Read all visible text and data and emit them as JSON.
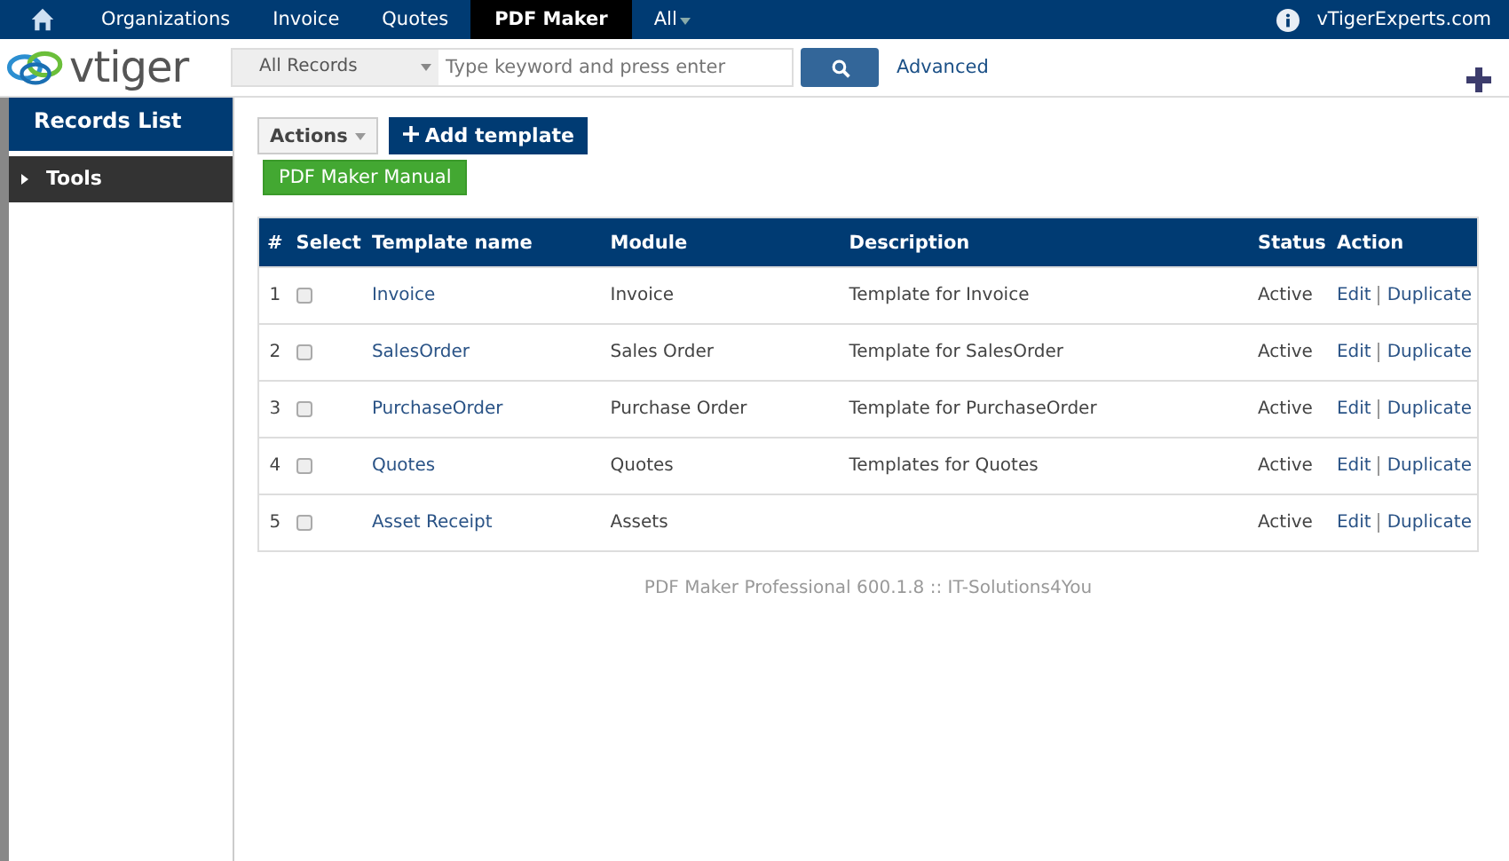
{
  "top_nav": {
    "tabs": [
      {
        "label": "Organizations",
        "selected": false
      },
      {
        "label": "Invoice",
        "selected": false
      },
      {
        "label": "Quotes",
        "selected": false
      },
      {
        "label": "PDF Maker",
        "selected": true
      },
      {
        "label": "All",
        "selected": false
      }
    ],
    "user": "vTigerExperts.com"
  },
  "header": {
    "logo": "vtiger",
    "filter": "All Records",
    "search": {
      "placeholder": "Type keyword and press enter"
    },
    "advanced": "Advanced"
  },
  "sidebar": {
    "title": "Records List",
    "items": [
      {
        "label": "Tools",
        "expanded": false
      }
    ]
  },
  "toolbar": {
    "actions": "Actions",
    "add": "Add template",
    "manual": "PDF Maker Manual"
  },
  "table": {
    "columns": [
      "#",
      "Select",
      "Template name",
      "Module",
      "Description",
      "Status",
      "Action"
    ],
    "rows": [
      {
        "num": "1",
        "checked": false,
        "name": "Invoice",
        "module": "Invoice",
        "description": "Template for Invoice",
        "status": "Active",
        "actions": [
          "Edit",
          "Duplicate"
        ]
      },
      {
        "num": "2",
        "checked": false,
        "name": "SalesOrder",
        "module": "Sales Order",
        "description": "Template for SalesOrder",
        "status": "Active",
        "actions": [
          "Edit",
          "Duplicate"
        ]
      },
      {
        "num": "3",
        "checked": false,
        "name": "PurchaseOrder",
        "module": "Purchase Order",
        "description": "Template for PurchaseOrder",
        "status": "Active",
        "actions": [
          "Edit",
          "Duplicate"
        ]
      },
      {
        "num": "4",
        "checked": false,
        "name": "Quotes",
        "module": "Quotes",
        "description": "Templates for Quotes",
        "status": "Active",
        "actions": [
          "Edit",
          "Duplicate"
        ]
      },
      {
        "num": "5",
        "checked": false,
        "name": "Asset Receipt",
        "module": "Assets",
        "status": "Active",
        "actions": [
          "Edit",
          "Duplicate"
        ]
      }
    ]
  },
  "footer": "PDF Maker Professional 600.1.8 :: IT-Solutions4You"
}
